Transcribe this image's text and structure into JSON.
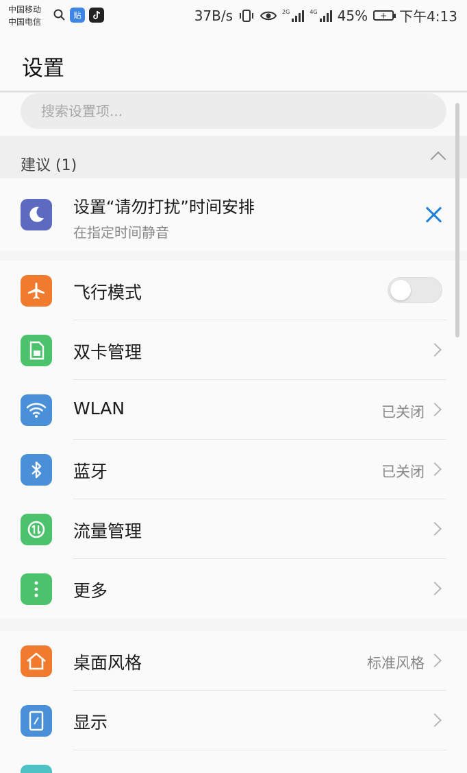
{
  "status_bar": {
    "carrier1": "中国移动",
    "carrier2": "中国电信",
    "app1_label": "贴",
    "net_speed": "37B/s",
    "sig1_tag": "2G",
    "sig2_tag": "4G",
    "battery_pct": "45%",
    "time": "下午4:13"
  },
  "header": {
    "title": "设置"
  },
  "search": {
    "placeholder": "搜索设置项..."
  },
  "suggestions": {
    "header": "建议 (1)",
    "items": [
      {
        "title": "设置“请勿打扰”时间安排",
        "subtitle": "在指定时间静音",
        "icon": "moon-icon",
        "icon_color": "#5c6bc0"
      }
    ]
  },
  "groups": [
    {
      "items": [
        {
          "label": "飞行模式",
          "icon": "airplane-icon",
          "color": "#f07b2f",
          "control": "toggle",
          "on": false
        },
        {
          "label": "双卡管理",
          "icon": "sim-card-icon",
          "color": "#4cc26d",
          "control": "chevron"
        },
        {
          "label": "WLAN",
          "icon": "wifi-icon",
          "color": "#4a90d9",
          "value": "已关闭",
          "control": "chevron"
        },
        {
          "label": "蓝牙",
          "icon": "bluetooth-icon",
          "color": "#4a90d9",
          "value": "已关闭",
          "control": "chevron"
        },
        {
          "label": "流量管理",
          "icon": "data-usage-icon",
          "color": "#4cc26d",
          "control": "chevron"
        },
        {
          "label": "更多",
          "icon": "more-icon",
          "color": "#4cc26d",
          "control": "chevron"
        }
      ]
    },
    {
      "items": [
        {
          "label": "桌面风格",
          "icon": "home-icon",
          "color": "#f07b2f",
          "value": "标准风格",
          "control": "chevron"
        },
        {
          "label": "显示",
          "icon": "display-icon",
          "color": "#4a90d9",
          "control": "chevron"
        },
        {
          "label": "",
          "icon": "sound-icon",
          "color": "#4cc2c4",
          "control": "chevron"
        }
      ]
    }
  ]
}
